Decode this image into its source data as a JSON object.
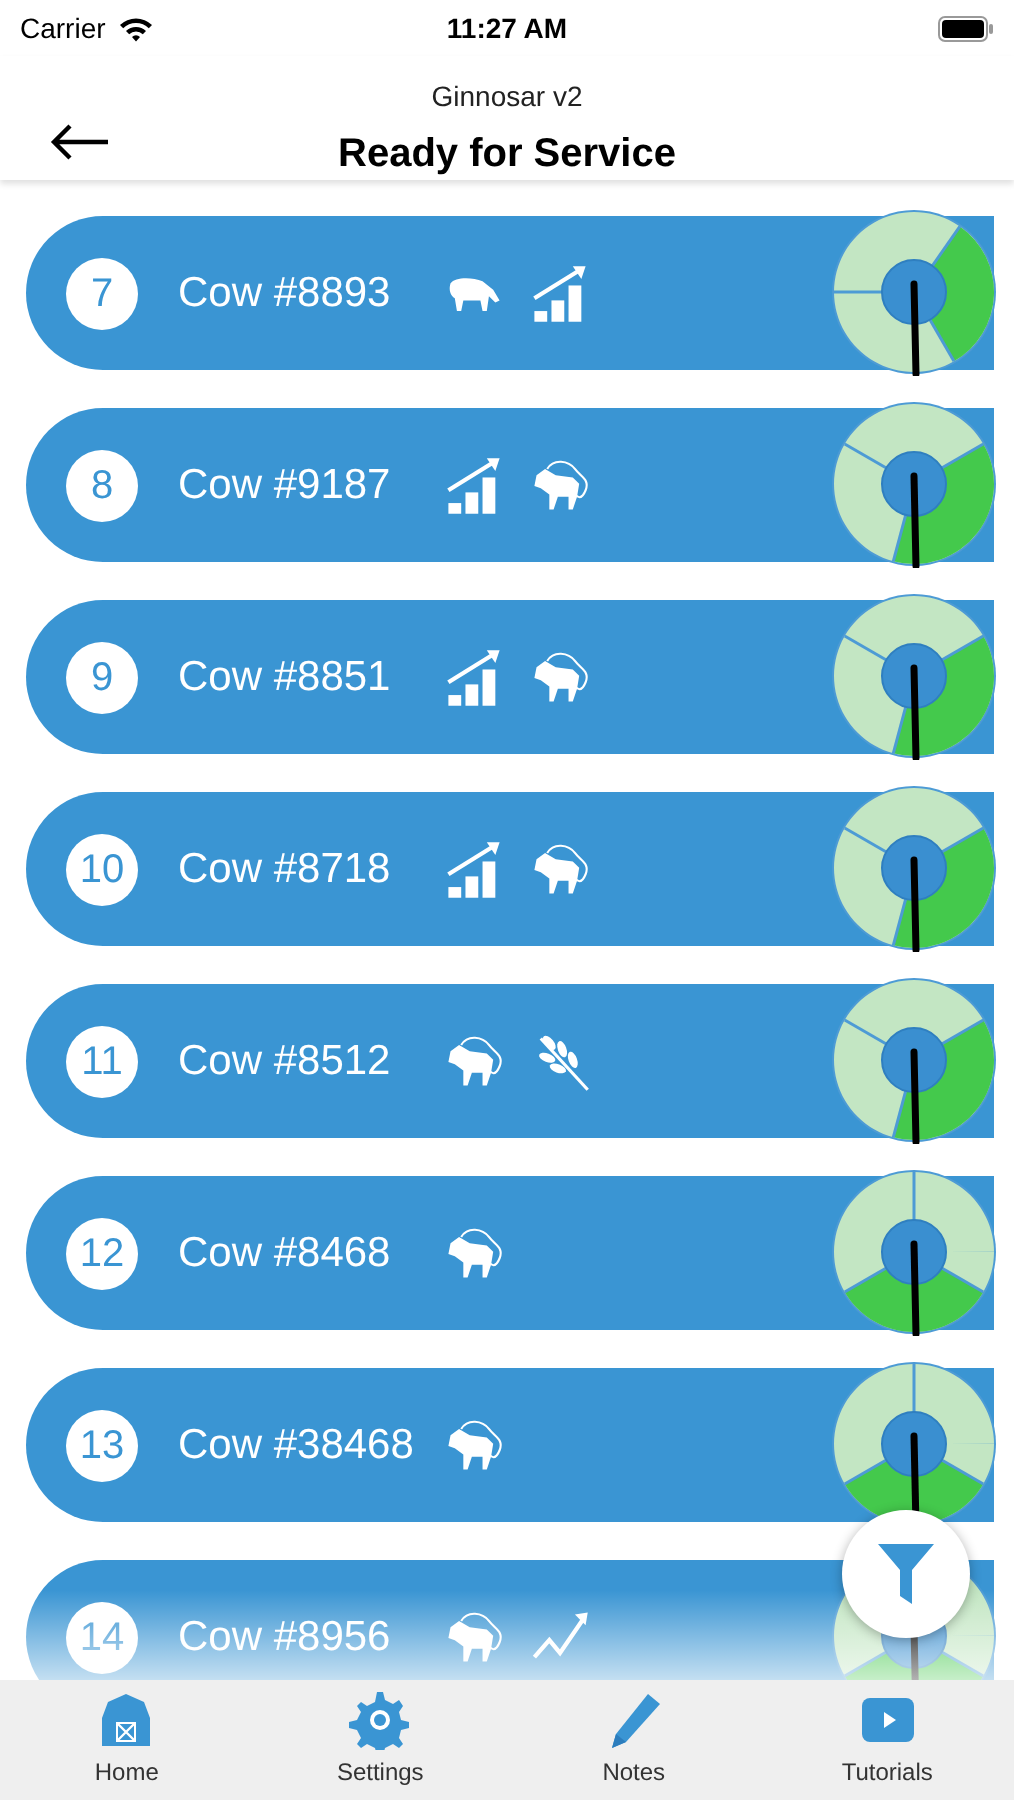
{
  "status_bar": {
    "carrier": "Carrier",
    "time": "11:27 AM"
  },
  "header": {
    "subtitle": "Ginnosar v2",
    "title": "Ready for Service"
  },
  "rows": [
    {
      "number": "7",
      "name": "Cow #8893",
      "icons": [
        {
          "kind": "grazing"
        },
        {
          "kind": "growth"
        }
      ],
      "gauge": {
        "kind": "right"
      }
    },
    {
      "number": "8",
      "name": "Cow #9187",
      "icons": [
        {
          "kind": "growth"
        },
        {
          "kind": "roped"
        }
      ],
      "gauge": {
        "kind": "lower-right"
      }
    },
    {
      "number": "9",
      "name": "Cow #8851",
      "icons": [
        {
          "kind": "growth"
        },
        {
          "kind": "roped"
        }
      ],
      "gauge": {
        "kind": "lower-right"
      }
    },
    {
      "number": "10",
      "name": "Cow #8718",
      "icons": [
        {
          "kind": "growth"
        },
        {
          "kind": "roped"
        }
      ],
      "gauge": {
        "kind": "lower-right"
      }
    },
    {
      "number": "11",
      "name": "Cow #8512",
      "icons": [
        {
          "kind": "roped"
        },
        {
          "kind": "wheat"
        }
      ],
      "gauge": {
        "kind": "lower-right"
      }
    },
    {
      "number": "12",
      "name": "Cow #8468",
      "icons": [
        {
          "kind": "roped"
        }
      ],
      "gauge": {
        "kind": "bottom"
      }
    },
    {
      "number": "13",
      "name": "Cow #38468",
      "icons": [
        {
          "kind": "roped"
        }
      ],
      "gauge": {
        "kind": "bottom"
      }
    },
    {
      "number": "14",
      "name": "Cow #8956",
      "icons": [
        {
          "kind": "roped"
        },
        {
          "kind": "trend"
        }
      ],
      "gauge": {
        "kind": "bottom"
      }
    }
  ],
  "tab_bar": [
    {
      "kind": "home",
      "label": "Home"
    },
    {
      "kind": "settings",
      "label": "Settings"
    },
    {
      "kind": "notes",
      "label": "Notes"
    },
    {
      "kind": "tutorials",
      "label": "Tutorials"
    }
  ]
}
